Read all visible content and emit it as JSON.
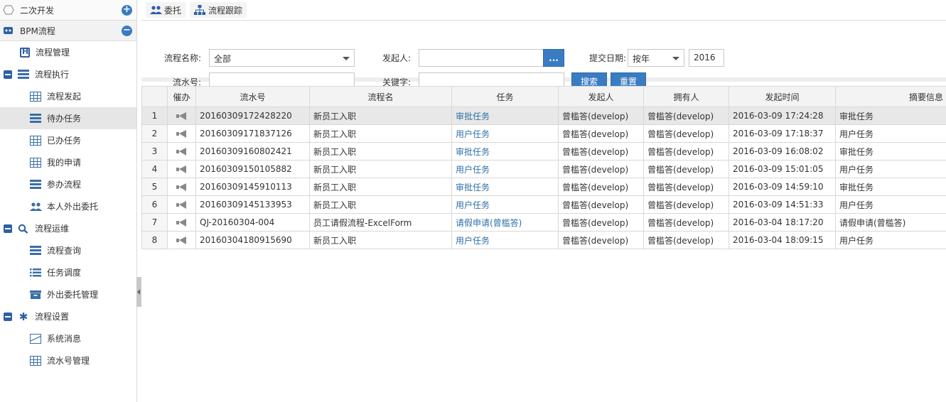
{
  "sidebar": {
    "sections": [
      {
        "label": "二次开发",
        "control": "+",
        "icon": "hexagon-icon"
      },
      {
        "label": "BPM流程",
        "control": "−",
        "icon": "bpm-icon"
      }
    ],
    "items": [
      {
        "label": "流程管理",
        "icon": "h-box-icon"
      },
      {
        "label": "流程执行",
        "icon": "list-icon",
        "group": true
      },
      {
        "label": "流程发起",
        "icon": "grid-icon"
      },
      {
        "label": "待办任务",
        "icon": "list-icon",
        "selected": true
      },
      {
        "label": "已办任务",
        "icon": "grid-icon"
      },
      {
        "label": "我的申请",
        "icon": "grid-icon"
      },
      {
        "label": "参办流程",
        "icon": "list-icon"
      },
      {
        "label": "本人外出委托",
        "icon": "users-icon"
      },
      {
        "label": "流程运维",
        "icon": "search-icon",
        "group": true
      },
      {
        "label": "流程查询",
        "icon": "list-icon"
      },
      {
        "label": "任务调度",
        "icon": "bullet-list-icon"
      },
      {
        "label": "外出委托管理",
        "icon": "archive-icon"
      },
      {
        "label": "流程设置",
        "icon": "asterisk-icon",
        "group": true
      },
      {
        "label": "系统消息",
        "icon": "envelope-icon"
      },
      {
        "label": "流水号管理",
        "icon": "grid-icon"
      }
    ]
  },
  "toolbar": {
    "delegate": "委托",
    "trace": "流程跟踪"
  },
  "search": {
    "process_name_label": "流程名称:",
    "process_name_value": "全部",
    "initiator_label": "发起人:",
    "initiator_value": "",
    "picker_label": "...",
    "submit_date_label": "提交日期:",
    "period_value": "按年",
    "year_value": "2016",
    "serial_label": "流水号:",
    "serial_value": "",
    "keyword_label": "关键字:",
    "keyword_value": "",
    "search_button": "搜索",
    "reset_button": "重置"
  },
  "table": {
    "columns": [
      "",
      "催办",
      "流水号",
      "流程名",
      "任务",
      "发起人",
      "拥有人",
      "发起时间",
      "摘要信息"
    ],
    "rows": [
      {
        "n": "1",
        "serial": "20160309172428220",
        "process": "新员工入职",
        "task": "审批任务",
        "initiator": "曾槛答(develop)",
        "owner": "曾槛答(develop)",
        "time": "2016-03-09 17:24:28",
        "summary": "审批任务"
      },
      {
        "n": "2",
        "serial": "20160309171837126",
        "process": "新员工入职",
        "task": "用户任务",
        "initiator": "曾槛答(develop)",
        "owner": "曾槛答(develop)",
        "time": "2016-03-09 17:18:37",
        "summary": "用户任务"
      },
      {
        "n": "3",
        "serial": "20160309160802421",
        "process": "新员工入职",
        "task": "审批任务",
        "initiator": "曾槛答(develop)",
        "owner": "曾槛答(develop)",
        "time": "2016-03-09 16:08:02",
        "summary": "审批任务"
      },
      {
        "n": "4",
        "serial": "20160309150105882",
        "process": "新员工入职",
        "task": "用户任务",
        "initiator": "曾槛答(develop)",
        "owner": "曾槛答(develop)",
        "time": "2016-03-09 15:01:05",
        "summary": "用户任务"
      },
      {
        "n": "5",
        "serial": "20160309145910113",
        "process": "新员工入职",
        "task": "审批任务",
        "initiator": "曾槛答(develop)",
        "owner": "曾槛答(develop)",
        "time": "2016-03-09 14:59:10",
        "summary": "审批任务"
      },
      {
        "n": "6",
        "serial": "20160309145133953",
        "process": "新员工入职",
        "task": "用户任务",
        "initiator": "曾槛答(develop)",
        "owner": "曾槛答(develop)",
        "time": "2016-03-09 14:51:33",
        "summary": "用户任务"
      },
      {
        "n": "7",
        "serial": "QJ-20160304-004",
        "process": "员工请假流程-ExcelForm",
        "task": "请假申请(曾槛答)",
        "initiator": "曾槛答(develop)",
        "owner": "曾槛答(develop)",
        "time": "2016-03-04 18:17:20",
        "summary": "请假申请(曾槛答)"
      },
      {
        "n": "8",
        "serial": "20160304180915690",
        "process": "新员工入职",
        "task": "用户任务",
        "initiator": "曾槛答(develop)",
        "owner": "曾槛答(develop)",
        "time": "2016-03-04 18:09:15",
        "summary": "用户任务"
      }
    ]
  },
  "colors": {
    "accent": "#3a7cc2",
    "link": "#2f6fa8",
    "icon": "#2e5fa3",
    "selected_row": "#e8e8e8"
  }
}
